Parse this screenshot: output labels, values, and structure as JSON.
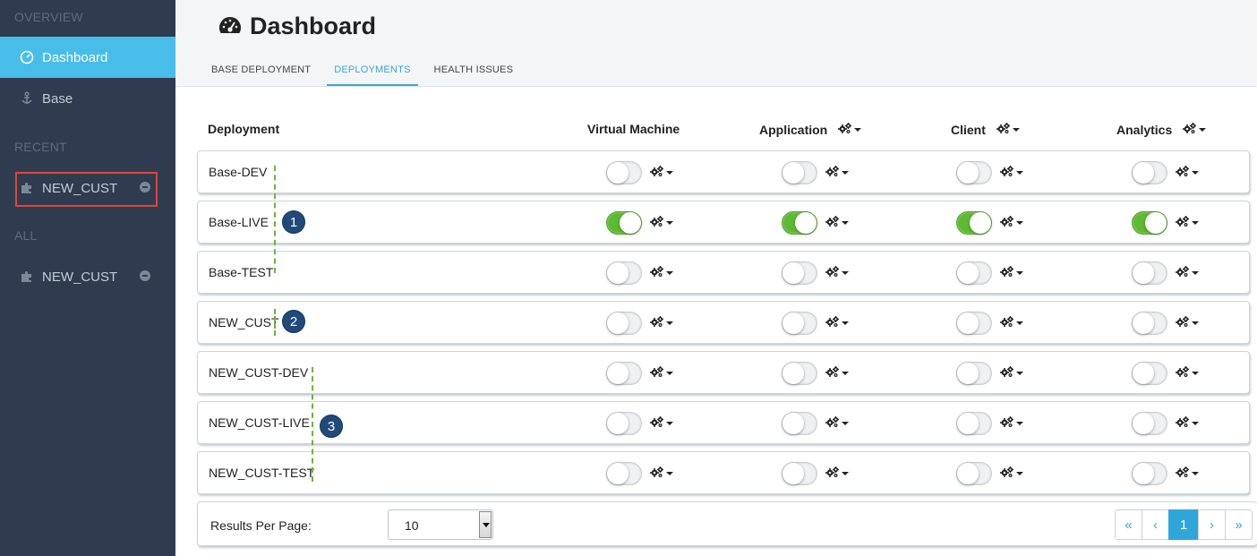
{
  "sidebar": {
    "sections": {
      "overview": "OVERVIEW",
      "recent": "RECENT",
      "all": "ALL"
    },
    "items": [
      {
        "label": "Dashboard",
        "icon": "dashboard-icon",
        "active": true
      },
      {
        "label": "Base",
        "icon": "anchor-icon",
        "active": false
      }
    ],
    "recent_items": [
      {
        "label": "NEW_CUST",
        "icon": "puzzle-icon"
      }
    ],
    "all_items": [
      {
        "label": "NEW_CUST",
        "icon": "puzzle-icon"
      }
    ]
  },
  "header": {
    "title": "Dashboard",
    "title_icon": "speedometer-icon",
    "tabs": [
      {
        "label": "BASE DEPLOYMENT",
        "active": false
      },
      {
        "label": "DEPLOYMENTS",
        "active": true
      },
      {
        "label": "HEALTH ISSUES",
        "active": false
      }
    ]
  },
  "table": {
    "columns": [
      "Deployment",
      "Virtual Machine",
      "Application",
      "Client",
      "Analytics"
    ],
    "rows": [
      {
        "name": "Base-DEV",
        "vm": false,
        "app": false,
        "client": false,
        "analytics": false
      },
      {
        "name": "Base-LIVE",
        "vm": true,
        "app": true,
        "client": true,
        "analytics": true
      },
      {
        "name": "Base-TEST",
        "vm": false,
        "app": false,
        "client": false,
        "analytics": false
      },
      {
        "name": "NEW_CUST",
        "vm": false,
        "app": false,
        "client": false,
        "analytics": false
      },
      {
        "name": "NEW_CUST-DEV",
        "vm": false,
        "app": false,
        "client": false,
        "analytics": false
      },
      {
        "name": "NEW_CUST-LIVE",
        "vm": false,
        "app": false,
        "client": false,
        "analytics": false
      },
      {
        "name": "NEW_CUST-TEST",
        "vm": false,
        "app": false,
        "client": false,
        "analytics": false
      }
    ]
  },
  "annotations": [
    "1",
    "2",
    "3"
  ],
  "footer": {
    "results_per_page_label": "Results Per Page:",
    "results_per_page_value": "10",
    "pager": [
      "«",
      "‹",
      "1",
      "›",
      "»"
    ],
    "current_page": "1"
  },
  "colors": {
    "sidebar_bg": "#2f3c4f",
    "active_item": "#49bde9",
    "toggle_on": "#5dbb2f",
    "highlight_box": "#e0453a",
    "badge": "#204a7a",
    "annotation_line": "#6fb33c"
  }
}
